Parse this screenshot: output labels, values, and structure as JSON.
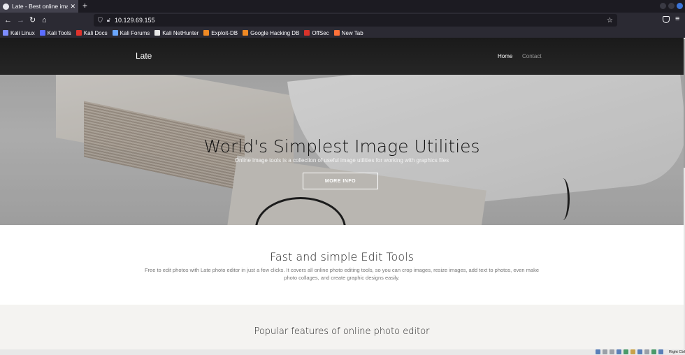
{
  "browser": {
    "tab": {
      "title": "Late - Best online image t",
      "favicon": "site-favicon"
    },
    "new_tab": "+",
    "url": "10.129.69.155",
    "bookmarks": [
      {
        "label": "Kali Linux",
        "icon": "kali-dragon-icon",
        "color": "#7d8cff"
      },
      {
        "label": "Kali Tools",
        "icon": "kali-tools-icon",
        "color": "#5b6dff"
      },
      {
        "label": "Kali Docs",
        "icon": "kali-docs-icon",
        "color": "#e0332c"
      },
      {
        "label": "Kali Forums",
        "icon": "kali-forums-icon",
        "color": "#6aa6ff"
      },
      {
        "label": "Kali NetHunter",
        "icon": "nethunter-icon",
        "color": "#e8e8e8"
      },
      {
        "label": "Exploit-DB",
        "icon": "exploit-db-icon",
        "color": "#f08a24"
      },
      {
        "label": "Google Hacking DB",
        "icon": "ghdb-icon",
        "color": "#f08a24"
      },
      {
        "label": "OffSec",
        "icon": "offsec-icon",
        "color": "#d8332a"
      },
      {
        "label": "New Tab",
        "icon": "firefox-icon",
        "color": "#ff7139"
      }
    ]
  },
  "site": {
    "brand": "Late",
    "nav": {
      "home": "Home",
      "contact": "Contact"
    },
    "hero": {
      "title": "World's Simplest Image Utilities",
      "lead": "Online image tools is a collection of useful image utilities for working with graphics files",
      "cta": "MORE INFO"
    },
    "features": {
      "title": "Fast and simple Edit Tools",
      "text": "Free to edit photos with Late photo editor in just a few clicks. It covers all online photo editing tools, so you can crop images, resize images, add text to photos, even make photo collages, and create graphic designs easily."
    },
    "popular": {
      "title": "Popular features of online photo editor"
    }
  },
  "vm_status": {
    "host_key": "Right Ctrl"
  }
}
